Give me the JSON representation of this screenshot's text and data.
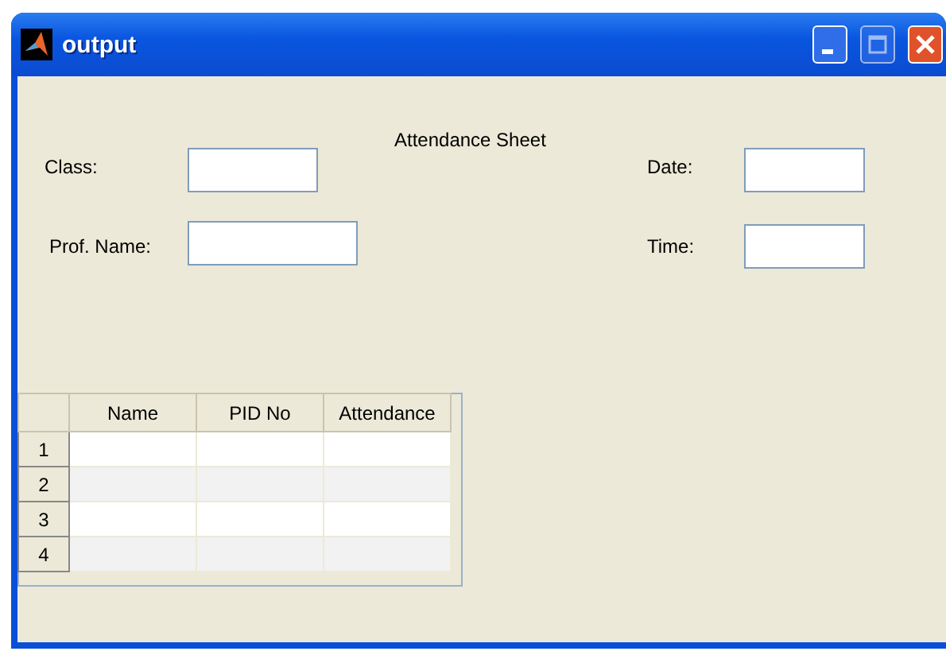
{
  "window": {
    "title": "output"
  },
  "heading": "Attendance Sheet",
  "fields": [
    {
      "label": "Class:"
    },
    {
      "label": "Prof. Name:"
    },
    {
      "label": "Date:"
    },
    {
      "label": "Time:"
    }
  ],
  "table": {
    "columns": [
      "Name",
      "PID No",
      "Attendance"
    ],
    "rows": [
      "1",
      "2",
      "3",
      "4"
    ]
  }
}
